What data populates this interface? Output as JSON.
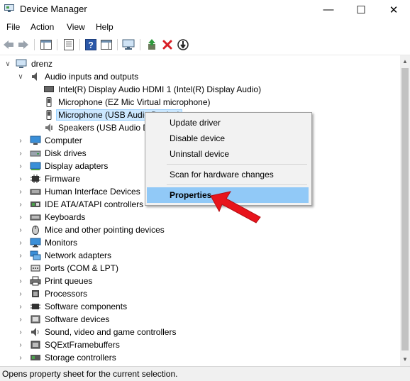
{
  "window": {
    "title": "Device Manager",
    "minimize": "—",
    "maximize": "☐",
    "close": "✕"
  },
  "menu": [
    "File",
    "Action",
    "View",
    "Help"
  ],
  "tree": {
    "root": "drenz",
    "audio": {
      "label": "Audio inputs and outputs",
      "children": [
        "Intel(R) Display Audio HDMI 1 (Intel(R) Display Audio)",
        "Microphone (EZ Mic Virtual microphone)",
        "Microphone (USB Audio Device)",
        "Speakers (USB Audio De"
      ]
    },
    "categories": [
      "Computer",
      "Disk drives",
      "Display adapters",
      "Firmware",
      "Human Interface Devices",
      "IDE ATA/ATAPI controllers",
      "Keyboards",
      "Mice and other pointing devices",
      "Monitors",
      "Network adapters",
      "Ports (COM & LPT)",
      "Print queues",
      "Processors",
      "Software components",
      "Software devices",
      "Sound, video and game controllers",
      "SQExtFramebuffers",
      "Storage controllers"
    ]
  },
  "context_menu": {
    "update": "Update driver",
    "disable": "Disable device",
    "uninstall": "Uninstall device",
    "scan": "Scan for hardware changes",
    "properties": "Properties"
  },
  "status": "Opens property sheet for the current selection.",
  "colors": {
    "highlight": "#91c9f7",
    "selection": "#cce8ff",
    "arrow": "#e8141c"
  }
}
